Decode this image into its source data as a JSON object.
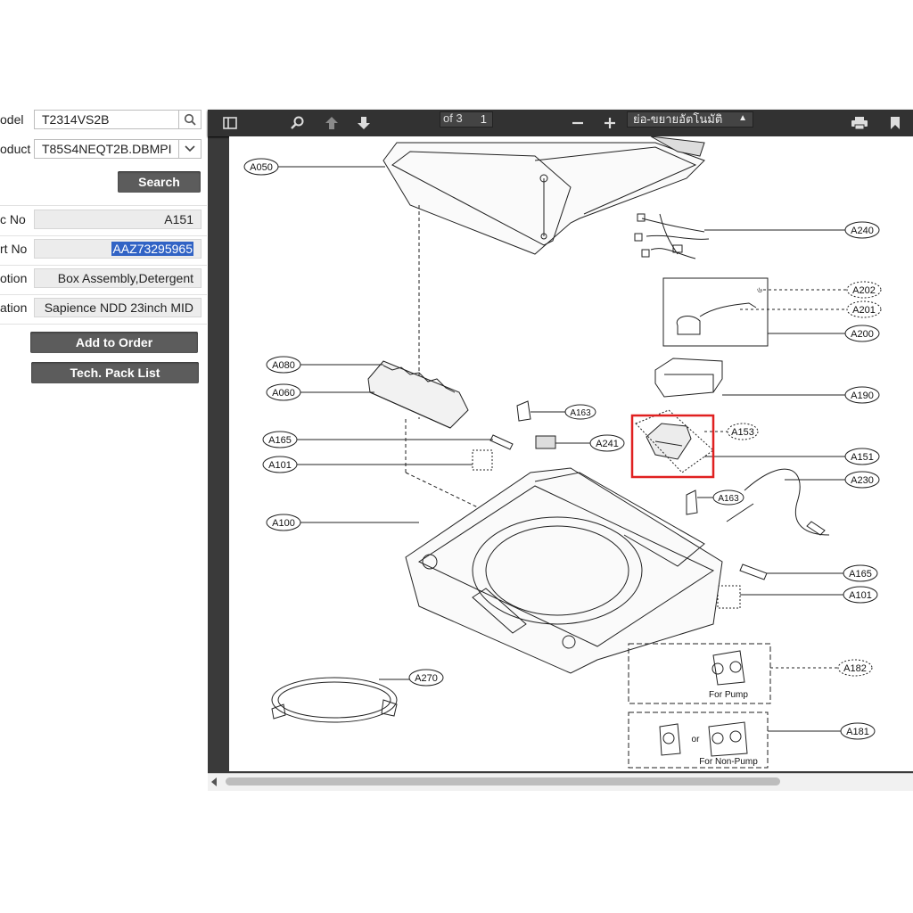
{
  "form": {
    "model": {
      "label": "odel",
      "value": "T2314VS2B"
    },
    "product": {
      "label": "oduct",
      "value": "T85S4NEQT2B.DBMPI"
    },
    "search_button": "Search",
    "loc_no": {
      "label": "c No",
      "value": "A151"
    },
    "part_no": {
      "label": "rt No",
      "value": "AAZ73295965"
    },
    "description": {
      "label": "otion",
      "value": "Box Assembly,Detergent"
    },
    "specification": {
      "label": "ation",
      "value": "Sapience NDD 23inch MID"
    },
    "add_to_order_button": "Add to Order",
    "tech_pack_button": "Tech. Pack List"
  },
  "viewer": {
    "page_number": "1",
    "page_of": "of 3",
    "zoom_label": "ย่อ-ขยายอัตโนมัติ",
    "icons": [
      "sidebar-toggle-icon",
      "search-icon",
      "arrow-up-icon",
      "arrow-down-icon",
      "zoom-out-icon",
      "zoom-in-icon",
      "print-icon",
      "bookmark-icon"
    ],
    "highlight_color": "#e02020"
  },
  "diagram": {
    "callouts": {
      "A050": "A050",
      "A240": "A240",
      "A202": "A202",
      "A201": "A201",
      "A200": "A200",
      "A080": "A080",
      "A060": "A060",
      "A190": "A190",
      "A163a": "A163",
      "A153": "A153",
      "A165a": "A165",
      "A241": "A241",
      "A151": "A151",
      "A101a": "A101",
      "A230": "A230",
      "A163b": "A163",
      "A100": "A100",
      "A165b": "A165",
      "A101b": "A101",
      "A182": "A182",
      "A270": "A270",
      "A181": "A181"
    },
    "for_pump": "For Pump",
    "for_non_pump": "For Non-Pump",
    "or_text": "or",
    "valve_mark": "৬"
  }
}
